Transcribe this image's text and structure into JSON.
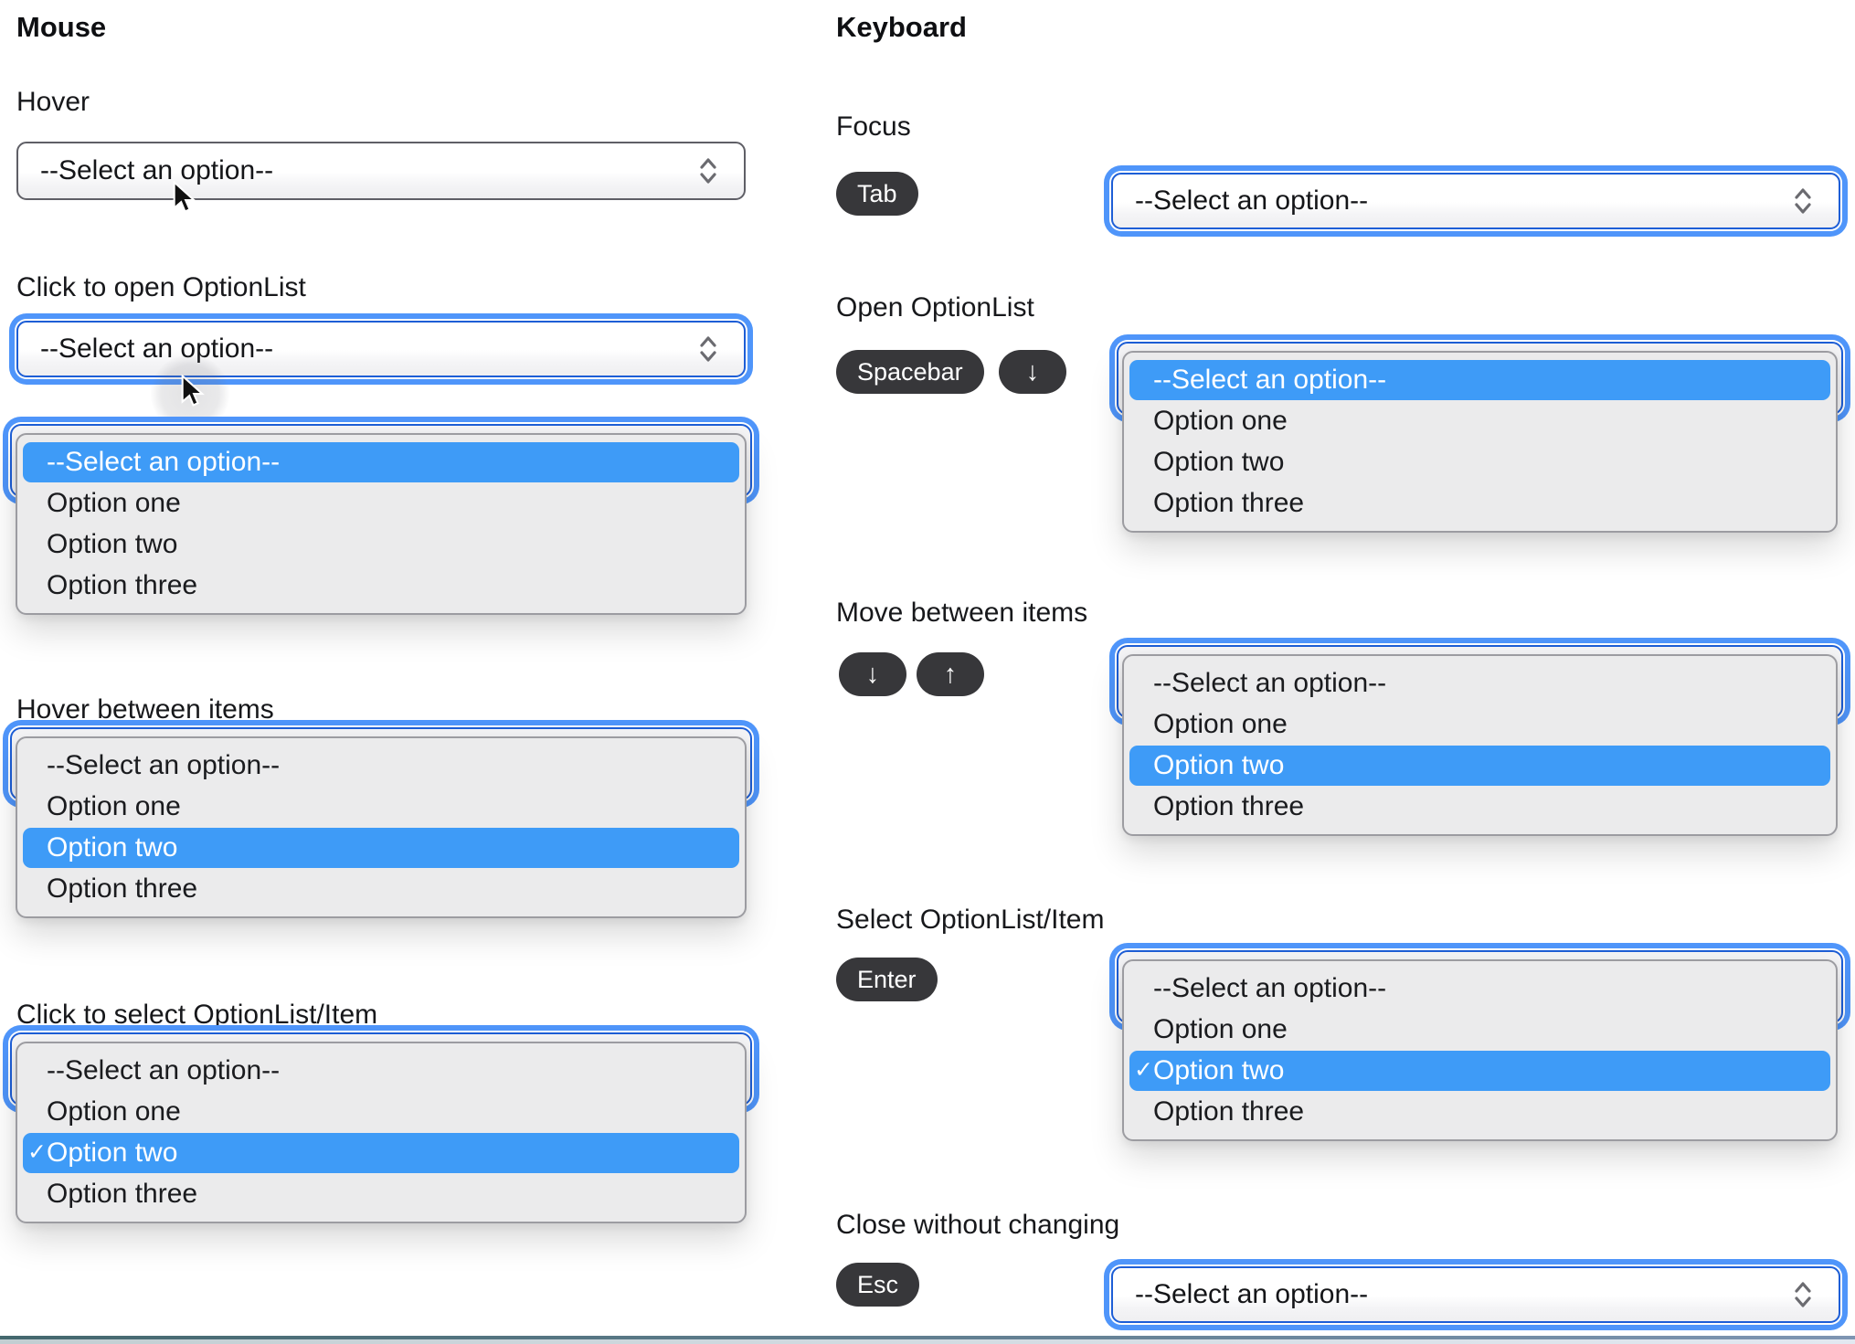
{
  "ui": {
    "placeholder": "--Select an option--",
    "options": [
      "--Select an option--",
      "Option one",
      "Option two",
      "Option three"
    ],
    "check_glyph": "✓",
    "mouse": {
      "title": "Mouse",
      "sections": {
        "hover": "Hover",
        "click_open": "Click to open OptionList",
        "hover_items": "Hover between items",
        "click_select": "Click to select OptionList/Item"
      }
    },
    "keyboard": {
      "title": "Keyboard",
      "sections": {
        "focus": "Focus",
        "open": "Open OptionList",
        "move": "Move between items",
        "select_item": "Select OptionList/Item",
        "close": "Close without changing"
      },
      "keys": {
        "tab": "Tab",
        "spacebar": "Spacebar",
        "down": "↓",
        "up": "↑",
        "enter": "Enter",
        "esc": "Esc"
      }
    },
    "colors": {
      "highlight_blue": "#3E9BF7",
      "focus_ring_blue": "#4F95FA",
      "focus_border_blue": "#1D5ED6",
      "list_background": "#EBEBEC",
      "key_pill_background": "#37373A"
    }
  }
}
